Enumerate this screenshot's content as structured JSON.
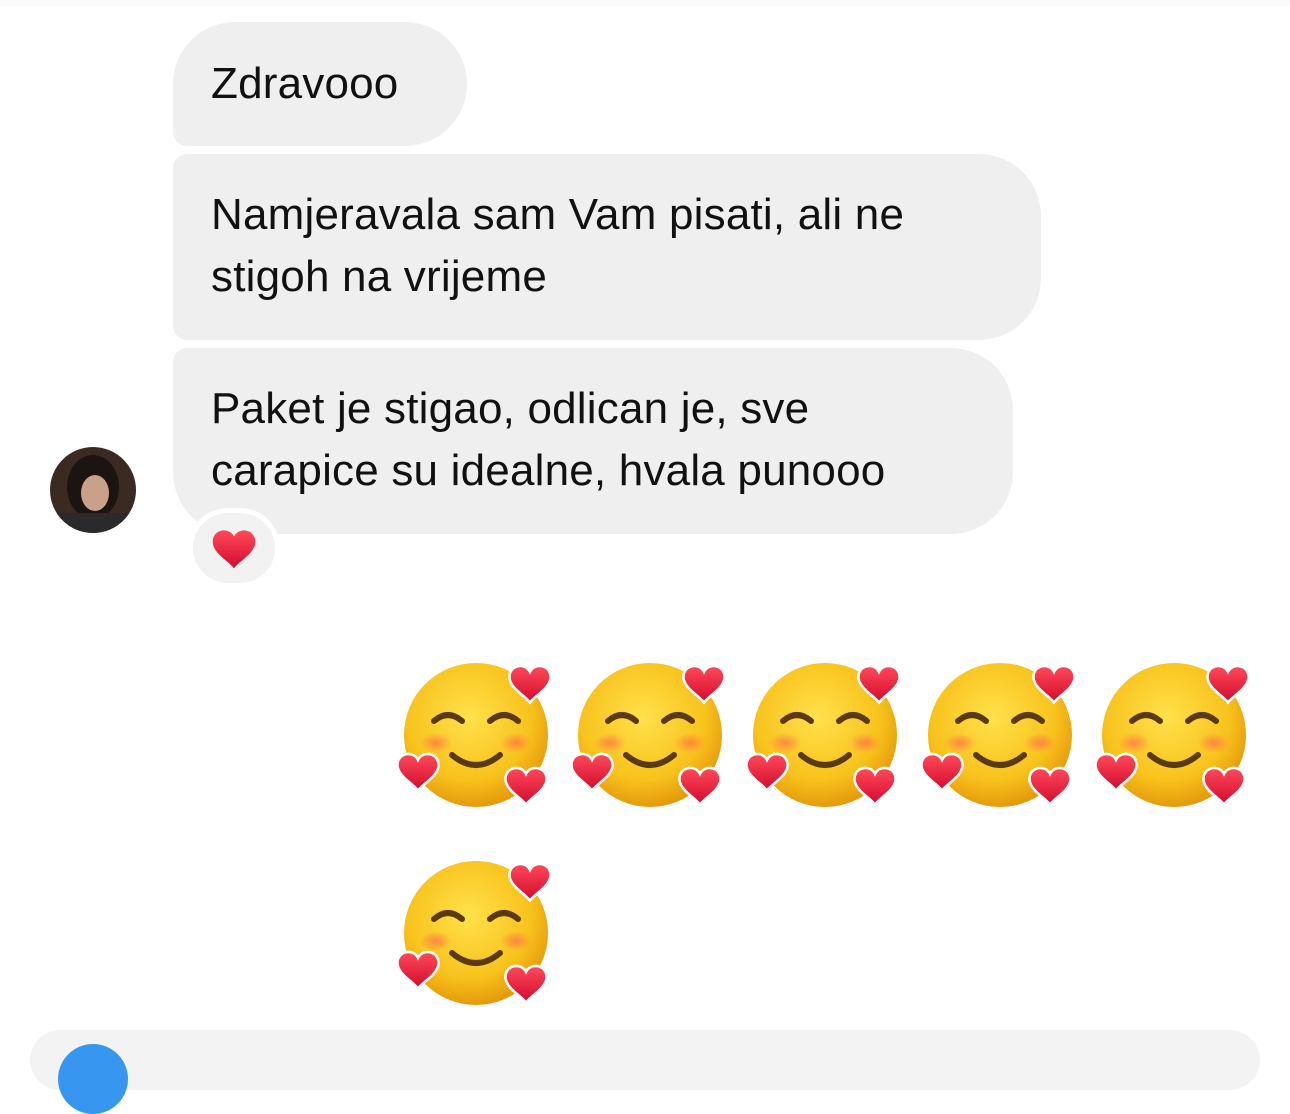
{
  "conversation": {
    "messages": [
      {
        "sender": "other",
        "lines": [
          "Zdravooo"
        ]
      },
      {
        "sender": "other",
        "lines": [
          "Namjeravala sam Vam pisati, ali ne",
          "stigoh na vrijeme"
        ]
      },
      {
        "sender": "other",
        "lines": [
          "Paket je stigao, odlican je, sve",
          "carapice su idealne, hvala punooo"
        ],
        "reaction": "heart"
      },
      {
        "sender": "me",
        "content": "smiling-face-with-hearts emoji ×6",
        "emoji_count": 6
      }
    ]
  },
  "icons": {
    "avatar": "contact-avatar",
    "reaction": "heart-icon",
    "emoji": "smiling-face-with-hearts-icon",
    "composer_button": "camera-icon"
  },
  "colors": {
    "bubble_bg": "#efefef",
    "text": "#111111",
    "heart": "#e0143c",
    "emoji_face": "#f8c21c",
    "accent": "#3797f0"
  }
}
